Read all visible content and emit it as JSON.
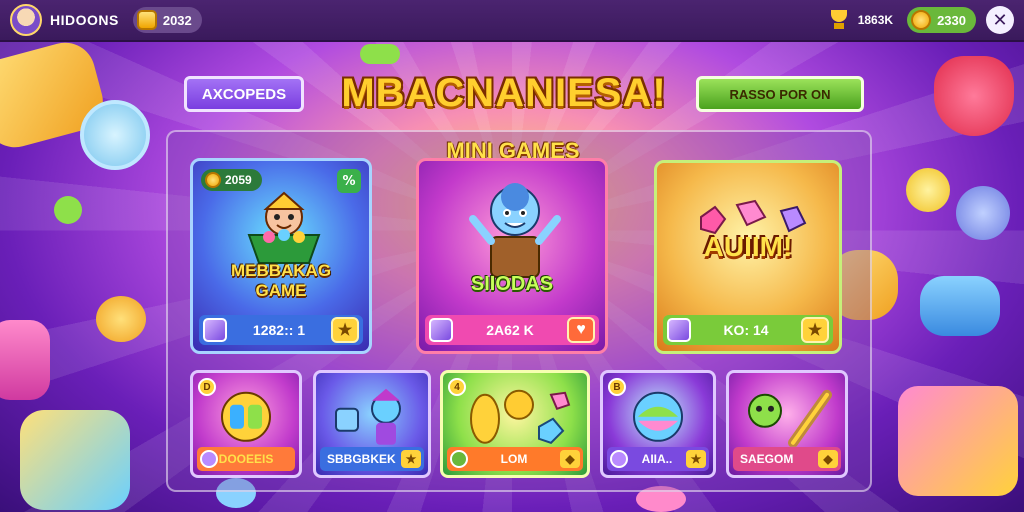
{
  "topbar": {
    "brand": "HIDOONS",
    "coins": "2032",
    "trophy_value": "1863K",
    "gems": "2330",
    "close_label": "✕"
  },
  "header": {
    "left_button": "AXCOPEDS",
    "title": "MBACNANIESA!",
    "right_button": "RASSO POR ON"
  },
  "section_title": "MINI GAMES",
  "featured_cards": [
    {
      "badge": "2059",
      "corner_icon": "%",
      "name_line1": "MEBBAKAG",
      "name_line2": "GAME",
      "footer_value": "1282:: 1",
      "action_icon": "★"
    },
    {
      "name": "SIIODAS",
      "footer_value": "2A62 K",
      "action_icon": "♥"
    },
    {
      "name": "AUIIM!",
      "footer_value": "KO: 14",
      "action_icon": "★"
    }
  ],
  "small_cards": [
    {
      "badge": "D",
      "label": "DOOEEIS",
      "action_icon": ""
    },
    {
      "badge": "",
      "label": "SBBGBKEK",
      "action_icon": "★"
    },
    {
      "badge": "4",
      "label": "LOM",
      "action_icon": "◆"
    },
    {
      "badge": "B",
      "label": "AIIA..",
      "action_icon": "★"
    },
    {
      "badge": "",
      "label": "SAEGOM",
      "action_icon": "◆"
    }
  ],
  "colors": {
    "topbar": "#3a1a5c",
    "title_gold": "#ffcf2e",
    "accent_green": "#6ab83b",
    "accent_purple": "#7a3ee0"
  }
}
